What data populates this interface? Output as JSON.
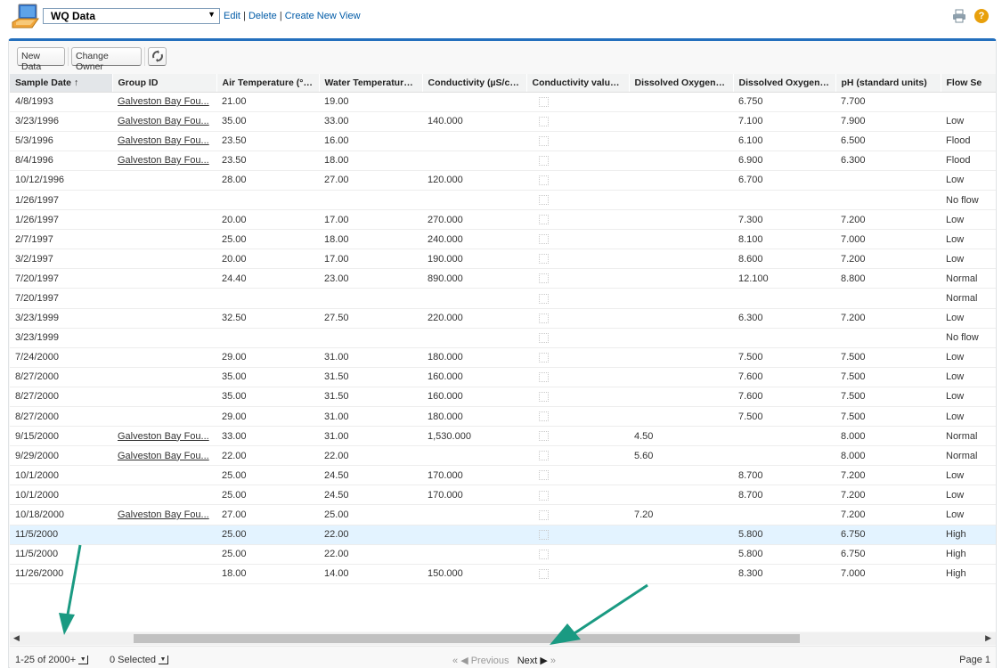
{
  "header": {
    "view_name": "WQ Data",
    "links": [
      "Edit",
      "Delete",
      "Create New View"
    ],
    "icons": [
      "laptop-icon",
      "print-icon",
      "help-icon"
    ],
    "help_glyph": "?"
  },
  "toolbar": {
    "new_label": "New Data",
    "owner_label": "Change Owner",
    "refresh_icon": "refresh-icon"
  },
  "table": {
    "columns": [
      "Sample Date ↑",
      "Group ID",
      "Air Temperature (° C)",
      "Water Temperature ...",
      "Conductivity (µS/cm)",
      "Conductivity values...",
      "Dissolved Oxygen (...",
      "Dissolved Oxygen ...",
      "pH (standard units)",
      "Flow Se"
    ],
    "sorted_column": "Sample Date",
    "highlighted_row": 22,
    "rows": [
      [
        "4/8/1993",
        "Galveston Bay Fou...",
        "21.00",
        "19.00",
        "",
        false,
        "",
        "6.750",
        "7.700",
        ""
      ],
      [
        "3/23/1996",
        "Galveston Bay Fou...",
        "35.00",
        "33.00",
        "140.000",
        false,
        "",
        "7.100",
        "7.900",
        "Low"
      ],
      [
        "5/3/1996",
        "Galveston Bay Fou...",
        "23.50",
        "16.00",
        "",
        false,
        "",
        "6.100",
        "6.500",
        "Flood"
      ],
      [
        "8/4/1996",
        "Galveston Bay Fou...",
        "23.50",
        "18.00",
        "",
        false,
        "",
        "6.900",
        "6.300",
        "Flood"
      ],
      [
        "10/12/1996",
        "",
        "28.00",
        "27.00",
        "120.000",
        false,
        "",
        "6.700",
        "",
        "Low"
      ],
      [
        "1/26/1997",
        "",
        "",
        "",
        "",
        false,
        "",
        "",
        "",
        "No flow"
      ],
      [
        "1/26/1997",
        "",
        "20.00",
        "17.00",
        "270.000",
        false,
        "",
        "7.300",
        "7.200",
        "Low"
      ],
      [
        "2/7/1997",
        "",
        "25.00",
        "18.00",
        "240.000",
        false,
        "",
        "8.100",
        "7.000",
        "Low"
      ],
      [
        "3/2/1997",
        "",
        "20.00",
        "17.00",
        "190.000",
        false,
        "",
        "8.600",
        "7.200",
        "Low"
      ],
      [
        "7/20/1997",
        "",
        "24.40",
        "23.00",
        "890.000",
        false,
        "",
        "12.100",
        "8.800",
        "Normal"
      ],
      [
        "7/20/1997",
        "",
        "",
        "",
        "",
        false,
        "",
        "",
        "",
        "Normal"
      ],
      [
        "3/23/1999",
        "",
        "32.50",
        "27.50",
        "220.000",
        false,
        "",
        "6.300",
        "7.200",
        "Low"
      ],
      [
        "3/23/1999",
        "",
        "",
        "",
        "",
        false,
        "",
        "",
        "",
        "No flow"
      ],
      [
        "7/24/2000",
        "",
        "29.00",
        "31.00",
        "180.000",
        false,
        "",
        "7.500",
        "7.500",
        "Low"
      ],
      [
        "8/27/2000",
        "",
        "35.00",
        "31.50",
        "160.000",
        false,
        "",
        "7.600",
        "7.500",
        "Low"
      ],
      [
        "8/27/2000",
        "",
        "35.00",
        "31.50",
        "160.000",
        false,
        "",
        "7.600",
        "7.500",
        "Low"
      ],
      [
        "8/27/2000",
        "",
        "29.00",
        "31.00",
        "180.000",
        false,
        "",
        "7.500",
        "7.500",
        "Low"
      ],
      [
        "9/15/2000",
        "Galveston Bay Fou...",
        "33.00",
        "31.00",
        "1,530.000",
        false,
        "4.50",
        "",
        "8.000",
        "Normal"
      ],
      [
        "9/29/2000",
        "Galveston Bay Fou...",
        "22.00",
        "22.00",
        "",
        false,
        "5.60",
        "",
        "8.000",
        "Normal"
      ],
      [
        "10/1/2000",
        "",
        "25.00",
        "24.50",
        "170.000",
        false,
        "",
        "8.700",
        "7.200",
        "Low"
      ],
      [
        "10/1/2000",
        "",
        "25.00",
        "24.50",
        "170.000",
        false,
        "",
        "8.700",
        "7.200",
        "Low"
      ],
      [
        "10/18/2000",
        "Galveston Bay Fou...",
        "27.00",
        "25.00",
        "",
        false,
        "7.20",
        "",
        "7.200",
        "Low"
      ],
      [
        "11/5/2000",
        "",
        "25.00",
        "22.00",
        "",
        false,
        "",
        "5.800",
        "6.750",
        "High"
      ],
      [
        "11/5/2000",
        "",
        "25.00",
        "22.00",
        "",
        false,
        "",
        "5.800",
        "6.750",
        "High"
      ],
      [
        "11/26/2000",
        "",
        "18.00",
        "14.00",
        "150.000",
        false,
        "",
        "8.300",
        "7.000",
        "High"
      ]
    ]
  },
  "footer": {
    "range": "1-25 of 2000+",
    "selected": "0 Selected",
    "first_glyph": "«",
    "prev_label": "Previous",
    "next_label": "Next",
    "last_glyph": "»",
    "page_label": "Page 1"
  },
  "annotations": {
    "arrow_color": "#1a9a82",
    "arrows": [
      "pointing-to-record-range",
      "pointing-to-next-link"
    ]
  },
  "colors": {
    "accent": "#236fbd",
    "link": "#015ba7",
    "row_highlight": "#e3f3ff"
  }
}
